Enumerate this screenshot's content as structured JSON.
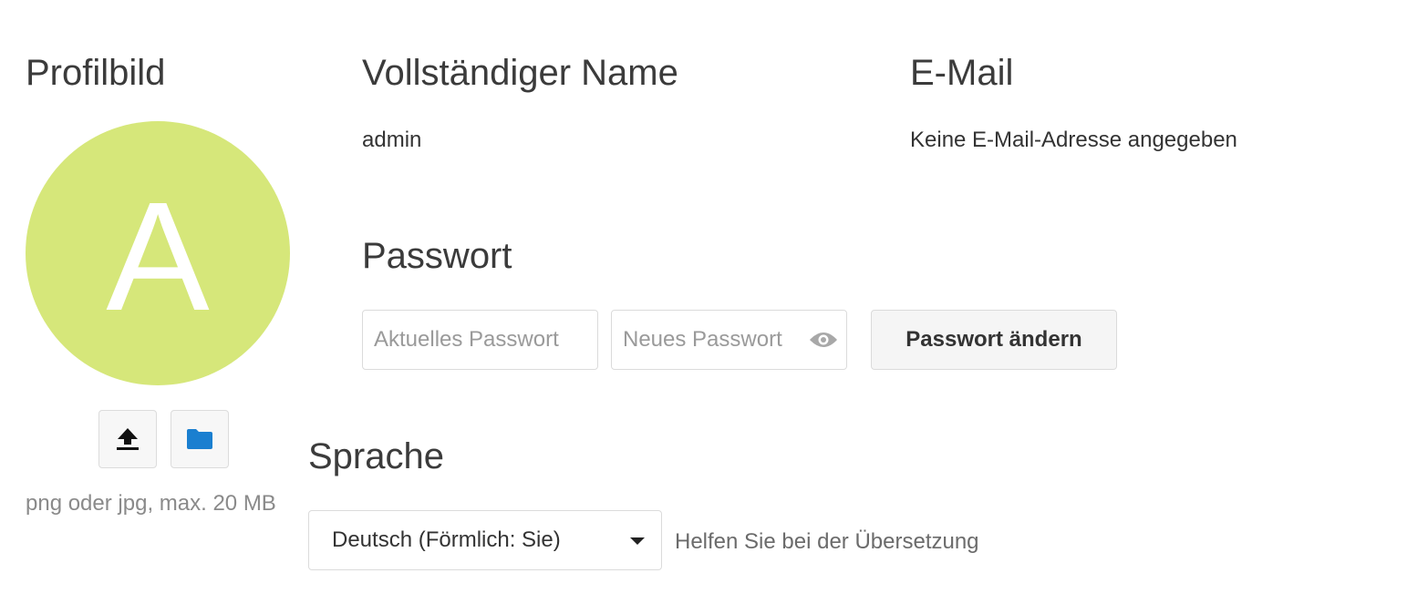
{
  "profile_picture": {
    "heading": "Profilbild",
    "avatar_letter": "A",
    "avatar_color": "#d6e77a",
    "upload_icon": "upload-icon",
    "folder_icon": "folder-icon",
    "hint": "png oder jpg, max. 20 MB"
  },
  "full_name": {
    "heading": "Vollständiger Name",
    "value": "admin"
  },
  "email": {
    "heading": "E-Mail",
    "value": "Keine E-Mail-Adresse angegeben"
  },
  "password": {
    "heading": "Passwort",
    "current_placeholder": "Aktuelles Passwort",
    "new_placeholder": "Neues Passwort",
    "show_icon": "eye-icon",
    "change_button": "Passwort ändern"
  },
  "language": {
    "heading": "Sprache",
    "selected": "Deutsch (Förmlich: Sie)",
    "help_link": "Helfen Sie bei der Übersetzung"
  },
  "colors": {
    "folder_icon": "#1a7fd0"
  }
}
